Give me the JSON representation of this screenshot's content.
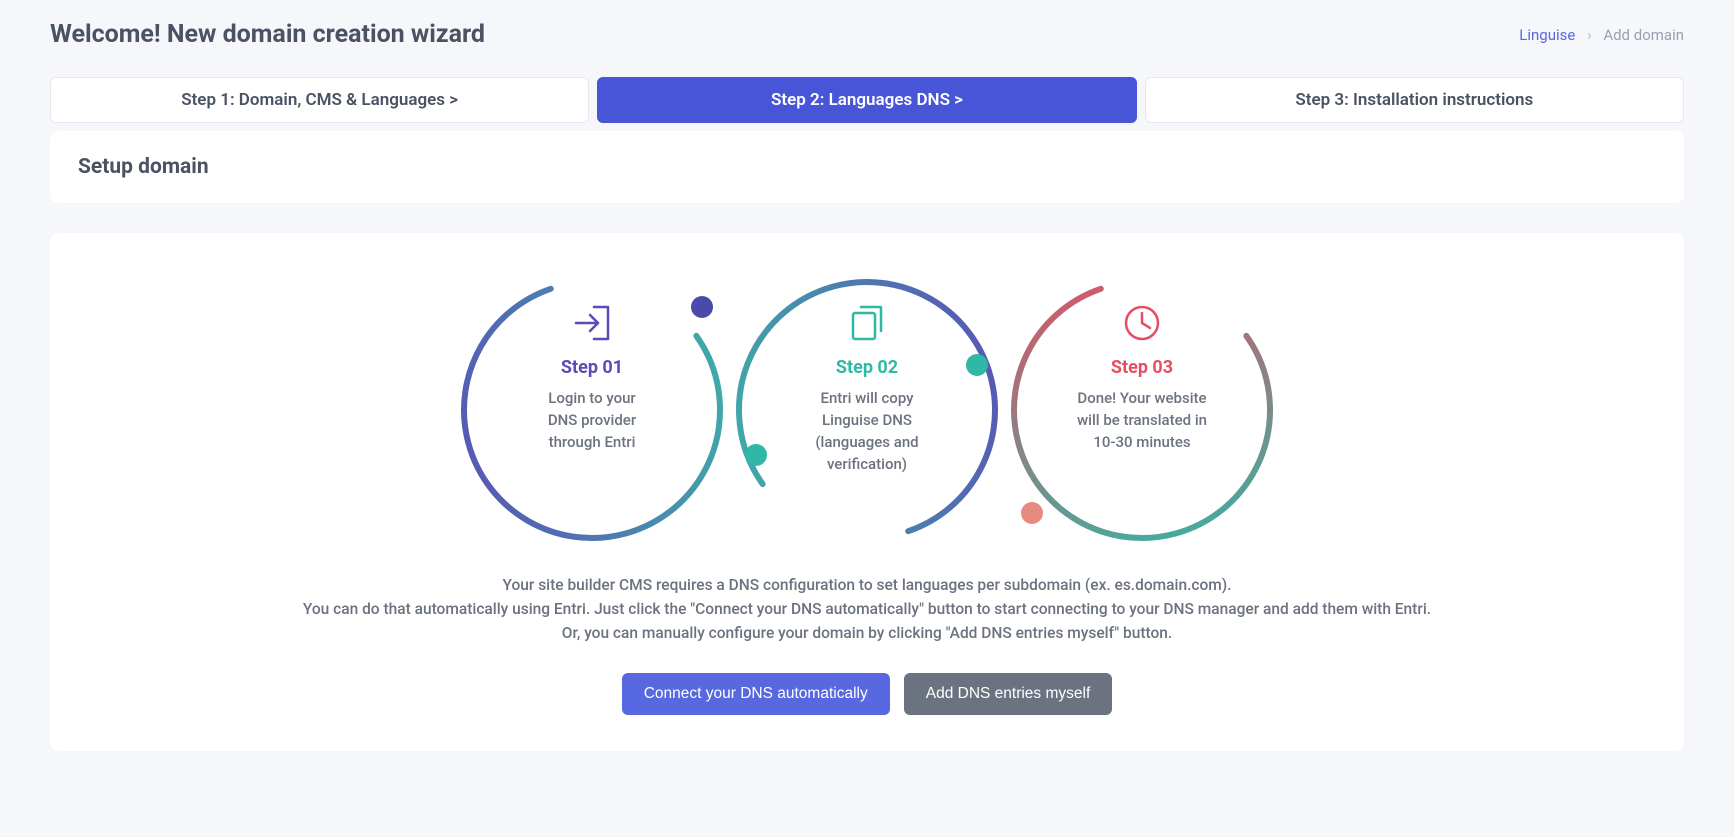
{
  "header": {
    "title": "Welcome! New domain creation wizard"
  },
  "breadcrumb": {
    "home": "Linguise",
    "sep": "›",
    "current": "Add domain"
  },
  "tabs": {
    "step1": "Step 1: Domain, CMS & Languages  >",
    "step2": "Step 2: Languages DNS  >",
    "step3": "Step 3: Installation instructions"
  },
  "section": {
    "setup_title": "Setup domain"
  },
  "diagram": {
    "s1_title": "Step 01",
    "s1_l1": "Login to your",
    "s1_l2": "DNS provider",
    "s1_l3": "through Entri",
    "s2_title": "Step 02",
    "s2_l1": "Entri will copy",
    "s2_l2": "Linguise DNS",
    "s2_l3": "(languages and",
    "s2_l4": "verification)",
    "s3_title": "Step 03",
    "s3_l1a": "Done!",
    "s3_l1b": " Your website",
    "s3_l2": "will be translated in",
    "s3_l3": "10-30 minutes"
  },
  "info": {
    "p1": "Your site builder CMS requires a DNS configuration to set languages per subdomain (ex. es.domain.com).",
    "p2": "You can do that automatically using Entri. Just click the \"Connect your DNS automatically\" button to start connecting to your DNS manager and add them with Entri.",
    "p3": "Or, you can manually configure your domain by clicking \"Add DNS entries myself\" button."
  },
  "buttons": {
    "connect": "Connect your DNS automatically",
    "manual": "Add DNS entries myself"
  }
}
